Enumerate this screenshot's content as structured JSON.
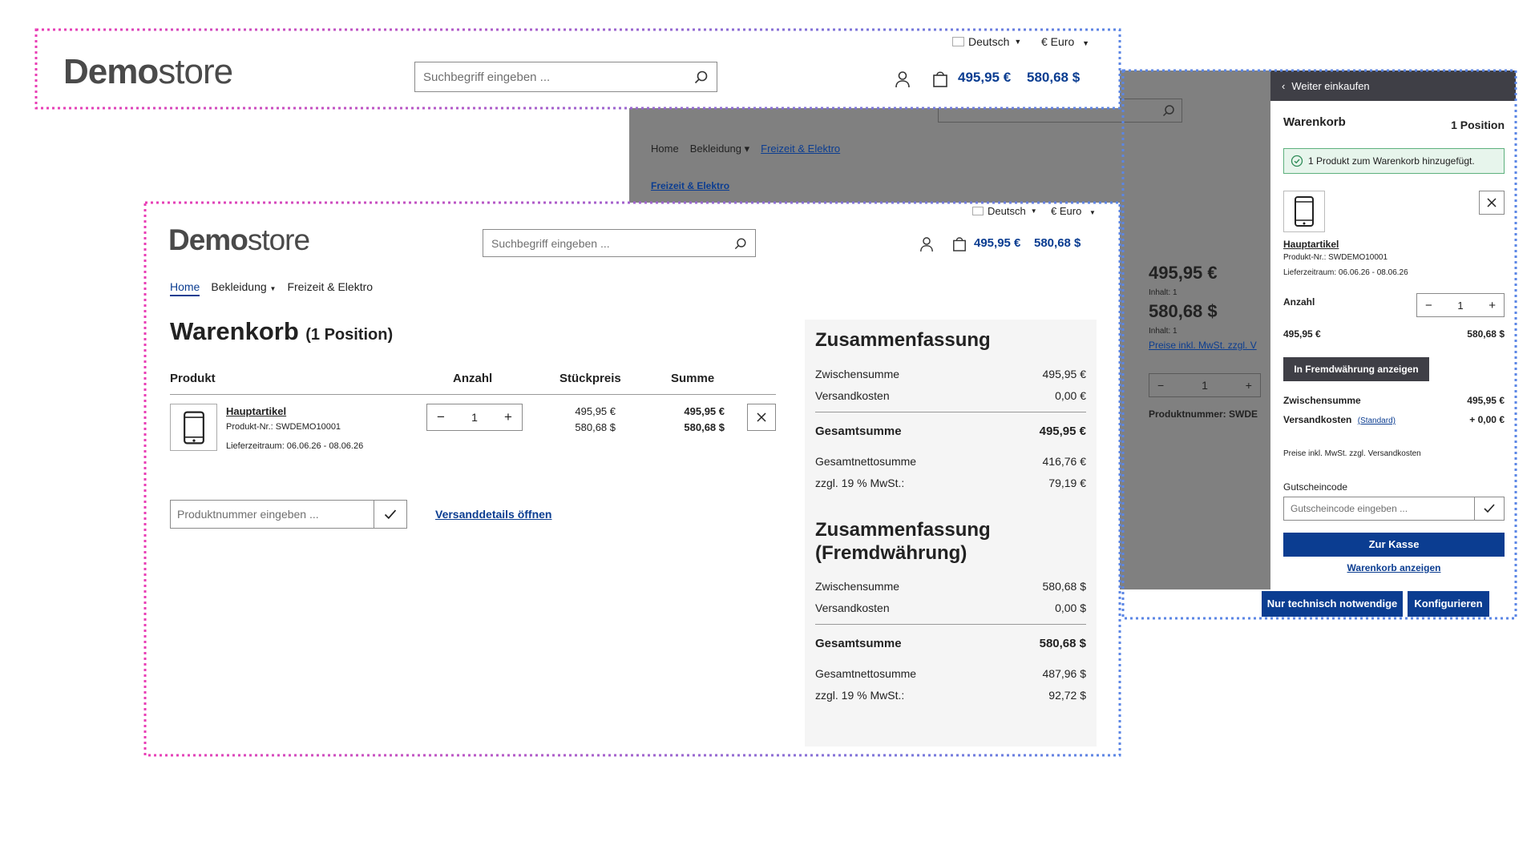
{
  "brand": {
    "bold": "Demo",
    "light": "store"
  },
  "header_top": {
    "lang_label": "Deutsch",
    "currency_label": "€ Euro",
    "search_placeholder": "Suchbegriff eingeben ...",
    "cart_price_eur": "495,95 €",
    "cart_price_usd": "580,68 $"
  },
  "bg_page": {
    "nav": [
      "Home",
      "Bekleidung",
      "Freizeit & Elektro"
    ],
    "breadcrumb": "Freizeit & Elektro",
    "price_eur": "495,95 €",
    "inhalt1": "Inhalt: 1",
    "price_usd": "580,68 $",
    "inhalt2": "Inhalt: 1",
    "tax_note": "Preise inkl. MwSt. zzgl. V",
    "qty": "1",
    "produktnummer": "Produktnummer: SWDE"
  },
  "cart_page": {
    "lang_label": "Deutsch",
    "currency_label": "€ Euro",
    "search_placeholder": "Suchbegriff eingeben ...",
    "cart_price_eur": "495,95 €",
    "cart_price_usd": "580,68 $",
    "nav": [
      "Home",
      "Bekleidung",
      "Freizeit & Elektro"
    ],
    "title": "Warenkorb",
    "title_count": "(1 Position)",
    "columns": [
      "Produkt",
      "Anzahl",
      "Stückpreis",
      "Summe"
    ],
    "item": {
      "name": "Hauptartikel",
      "number": "Produkt-Nr.: SWDEMO10001",
      "delivery": "Lieferzeitraum: 06.06.26 - 08.06.26",
      "qty": "1",
      "unit_eur": "495,95 €",
      "unit_usd": "580,68 $",
      "sum_eur": "495,95 €",
      "sum_usd": "580,68 $"
    },
    "product_input_placeholder": "Produktnummer eingeben ...",
    "shipping_link": "Versanddetails öffnen",
    "summary": {
      "title": "Zusammenfassung",
      "rows": [
        {
          "label": "Zwischensumme",
          "value": "495,95 €"
        },
        {
          "label": "Versandkosten",
          "value": "0,00 €"
        }
      ],
      "total_label": "Gesamtsumme",
      "total_value": "495,95 €",
      "net_rows": [
        {
          "label": "Gesamtnettosumme",
          "value": "416,76 €"
        },
        {
          "label": "zzgl. 19 % MwSt.:",
          "value": "79,19 €"
        }
      ]
    },
    "summary_fx": {
      "title_line1": "Zusammenfassung",
      "title_line2": "(Fremdwährung)",
      "rows": [
        {
          "label": "Zwischensumme",
          "value": "580,68 $"
        },
        {
          "label": "Versandkosten",
          "value": "0,00 $"
        }
      ],
      "total_label": "Gesamtsumme",
      "total_value": "580,68 $",
      "net_rows": [
        {
          "label": "Gesamtnettosumme",
          "value": "487,96 $"
        },
        {
          "label": "zzgl. 19 % MwSt.:",
          "value": "92,72 $"
        }
      ]
    }
  },
  "offcanvas": {
    "back_label": "Weiter einkaufen",
    "title": "Warenkorb",
    "count": "1 Position",
    "success_msg": "1 Produkt zum Warenkorb hinzugefügt.",
    "item_name": "Hauptartikel",
    "item_number": "Produkt-Nr.: SWDEMO10001",
    "item_delivery": "Lieferzeitraum: 06.06.26 - 08.06.26",
    "qty_label": "Anzahl",
    "qty": "1",
    "price_eur": "495,95 €",
    "price_usd": "580,68 $",
    "fx_button": "In Fremdwährung anzeigen",
    "subtotal_label": "Zwischensumme",
    "subtotal_value": "495,95 €",
    "shipping_label": "Versandkosten",
    "shipping_link": "(Standard)",
    "shipping_value": "+ 0,00 €",
    "tax_note": "Preise inkl. MwSt. zzgl. Versandkosten",
    "voucher_label": "Gutscheincode",
    "voucher_placeholder": "Gutscheincode eingeben ...",
    "checkout_button": "Zur Kasse",
    "view_cart_link": "Warenkorb anzeigen"
  },
  "cookie": {
    "btn_necessary": "Nur technisch notwendige",
    "btn_configure": "Konfigurieren"
  },
  "colors": {
    "accent": "#0b3d91",
    "frame_pink": "#e93fb6",
    "frame_blue": "#5b86e5",
    "overlay_gray": "#808080"
  }
}
